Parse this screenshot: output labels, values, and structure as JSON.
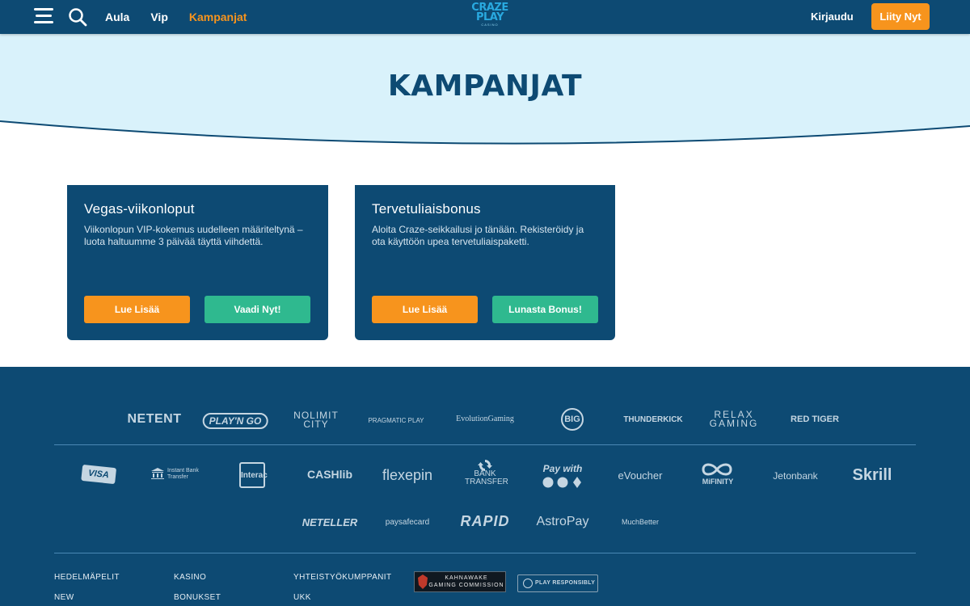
{
  "header": {
    "nav": [
      "Aula",
      "Vip",
      "Kampanjat"
    ],
    "active_nav": "Kampanjat",
    "logo": {
      "line1": "CRAZE",
      "line2": "PLAY",
      "line3": "CASINO"
    },
    "login_label": "Kirjaudu",
    "join_label": "Liity Nyt",
    "menu_icon": "hamburger-menu-icon",
    "search_icon": "search-icon"
  },
  "hero": {
    "title": "KAMPANJAT"
  },
  "promotions": [
    {
      "title": "Vegas-viikonloput",
      "description": "Viikonlopun VIP-kokemus uudelleen määriteltynä – luota haltuumme 3 päivää täyttä viihdettä.",
      "primary_button": "Lue Lisää",
      "secondary_button": "Vaadi Nyt!"
    },
    {
      "title": "Tervetuliaisbonus",
      "description": "Aloita Craze-seikkailusi jo tänään. Rekisteröidy ja ota käyttöön upea tervetuliaispaketti.",
      "primary_button": "Lue Lisää",
      "secondary_button": "Lunasta Bonus!"
    }
  ],
  "footer": {
    "providers": [
      "NETENT",
      "PLAY'N GO",
      "NOLIMIT CITY",
      "PRAGMATIC PLAY",
      "EvolutionGaming",
      "BIG",
      "THUNDERKICK",
      "RELAX GAMING",
      "RED TIGER"
    ],
    "payments_row1": [
      "VISA",
      "Instant Bank Transfer",
      "Interac",
      "CASHlib",
      "flexepin",
      "BANK TRANSFER",
      "Pay with",
      "eVoucher",
      "MiFINITY",
      "Jetonbank",
      "Skrill"
    ],
    "payments_row2": [
      "NETELLER",
      "paysafecard",
      "RAPID",
      "AstroPay",
      "MuchBetter"
    ],
    "links_col1": [
      "HEDELMÄPELIT",
      "NEW"
    ],
    "links_col2": [
      "KASINO",
      "BONUKSET"
    ],
    "links_col3": [
      "YHTEISTYÖKUMPPANIT",
      "UKK"
    ],
    "kahnawake": {
      "line1": "KAHNAWAKE",
      "line2": "GAMING COMMISSION"
    },
    "play_responsibly": "PLAY RESPONSIBLY"
  },
  "colors": {
    "navy": "#0d4a73",
    "orange": "#f7941d",
    "green": "#2fb98f",
    "hero_bg": "#d9f2fb"
  }
}
